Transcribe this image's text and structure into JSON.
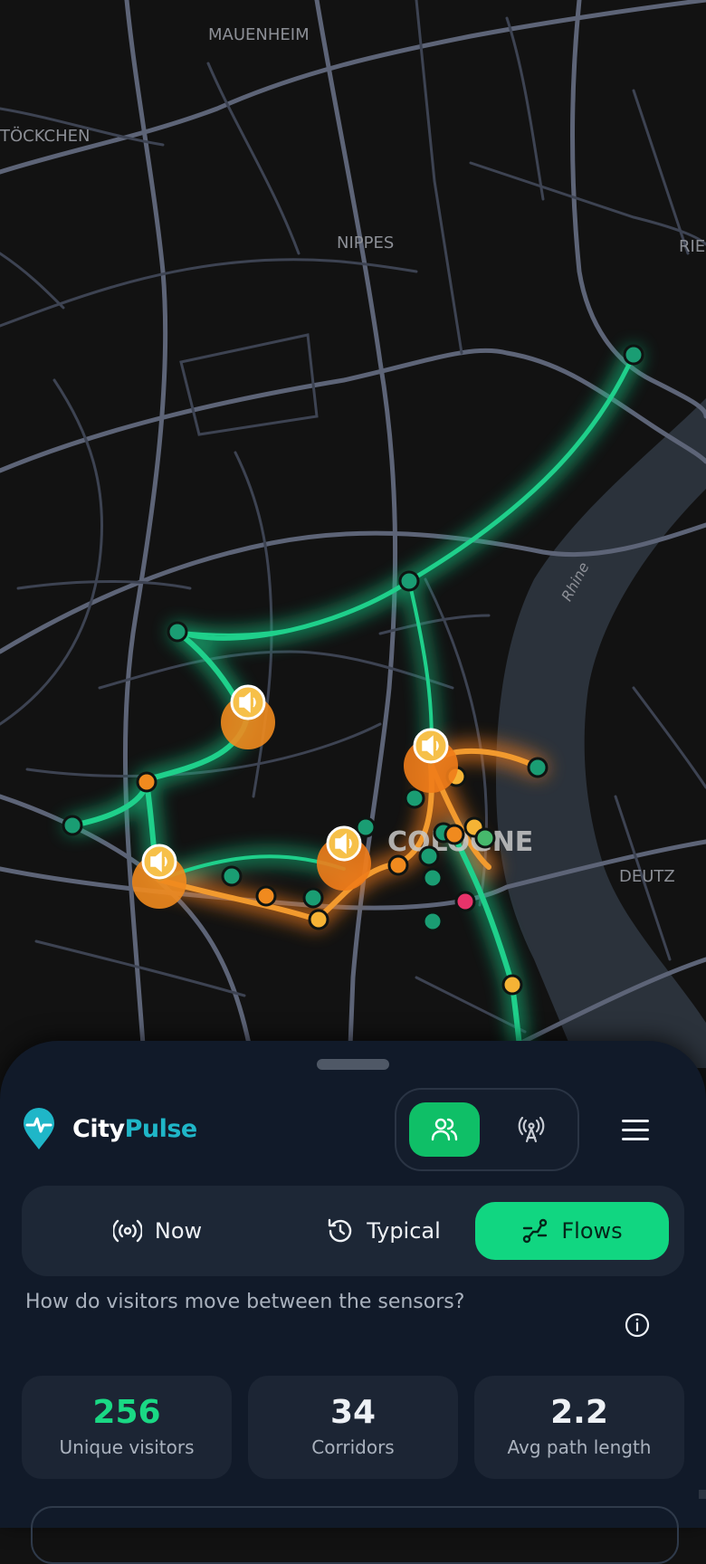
{
  "map": {
    "labels": {
      "mauenheim": "MAUENHEIM",
      "stockchen": "TÖCKCHEN",
      "nippes": "NIPPES",
      "riehl": "RIE",
      "rhine": "Rhine",
      "cologne": "COLOGNE",
      "deutz": "DEUTZ"
    },
    "colors": {
      "background": "#121212",
      "river": "#2b323b",
      "road": "#5a6072",
      "flow_green": "#15c784",
      "flow_orange": "#f07c1a",
      "sensor_green": "#1a9d73",
      "sensor_orange": "#f08a1e",
      "sensor_yellow": "#f5b335",
      "sensor_pink": "#e8336a"
    },
    "speaker_markers_icon": "speaker-icon"
  },
  "app": {
    "name_part1": "City",
    "name_part2": "Pulse",
    "logo_icon": "pin-pulse-icon"
  },
  "toggle": {
    "left_icon": "people-icon",
    "right_icon": "antenna-icon",
    "active": "left"
  },
  "menu_icon": "hamburger-icon",
  "modes": [
    {
      "label": "Now",
      "icon": "broadcast-icon"
    },
    {
      "label": "Typical",
      "icon": "history-icon"
    },
    {
      "label": "Flows",
      "icon": "route-icon"
    }
  ],
  "active_mode": "Flows",
  "question": "How do visitors move between the sensors?",
  "info_icon": "info-icon",
  "stats": [
    {
      "value": "256",
      "label": "Unique visitors"
    },
    {
      "value": "34",
      "label": "Corridors"
    },
    {
      "value": "2.2",
      "label": "Avg path length"
    }
  ]
}
